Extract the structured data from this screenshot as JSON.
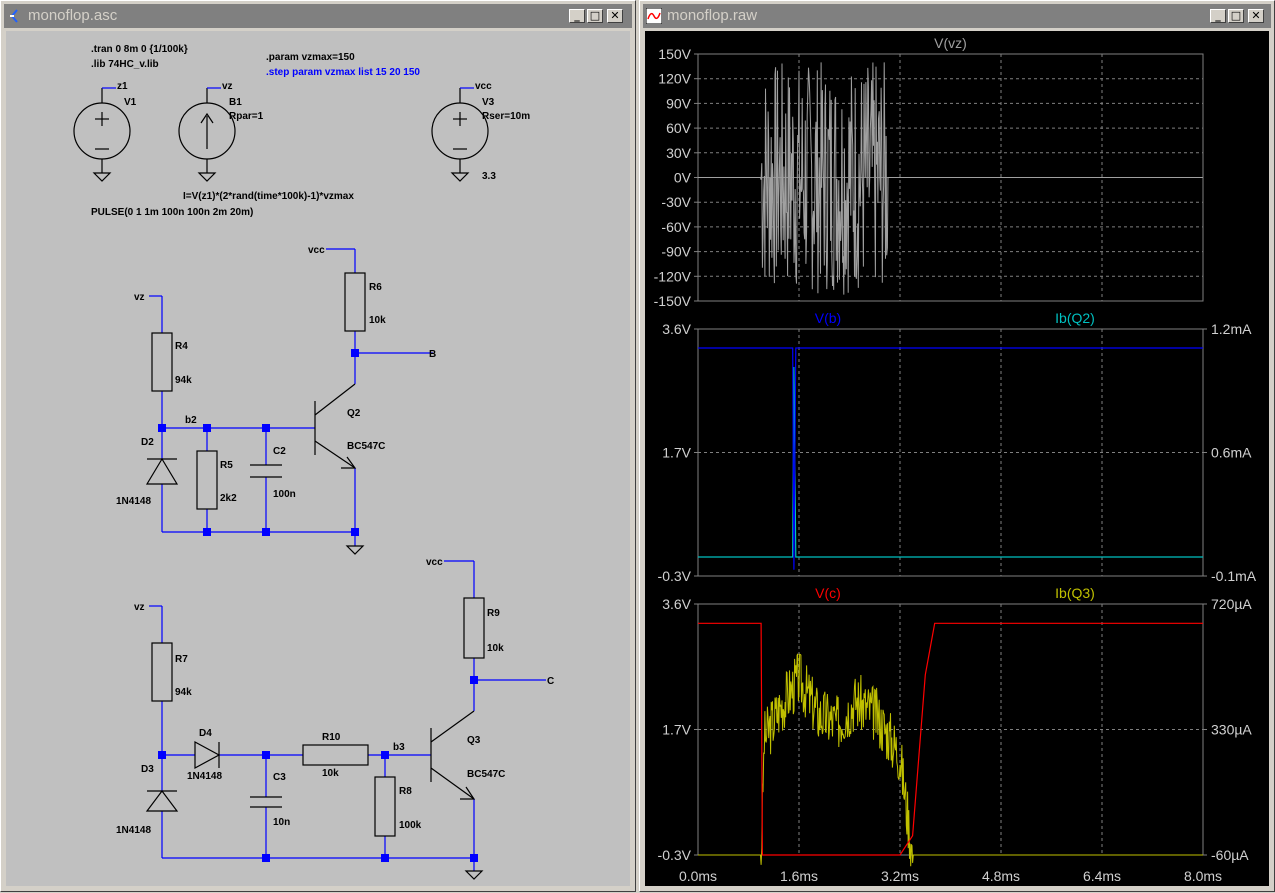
{
  "schematic_window": {
    "title": "monoflop.asc",
    "buttons": {
      "minimize": "_",
      "maximize": "□",
      "close": "✕"
    },
    "directives": {
      "tran": ".tran 0 8m 0 {1/100k}",
      "lib": ".lib 74HC_v.lib",
      "param": ".param vzmax=150",
      "step": ".step param vzmax list 15 20 150"
    },
    "components": {
      "v1": {
        "name": "V1",
        "net": "z1",
        "value": "PULSE(0 1 1m 100n 100n 2m 20m)"
      },
      "b1": {
        "name": "B1",
        "net": "vz",
        "attr": "Rpar=1",
        "value": "I=V(z1)*(2*rand(time*100k)-1)*vzmax"
      },
      "v3": {
        "name": "V3",
        "net": "vcc",
        "attr": "Rser=10m",
        "value": "3.3"
      },
      "r6": {
        "name": "R6",
        "value": "10k",
        "net": "vcc"
      },
      "r4": {
        "name": "R4",
        "value": "94k",
        "net": "vz"
      },
      "q2": {
        "name": "Q2",
        "value": "BC547C"
      },
      "d2": {
        "name": "D2",
        "value": "1N4148"
      },
      "r5": {
        "name": "R5",
        "value": "2k2"
      },
      "c2": {
        "name": "C2",
        "value": "100n"
      },
      "node_b2": "b2",
      "label_b": "B",
      "r9": {
        "name": "R9",
        "value": "10k",
        "net": "vcc"
      },
      "r7": {
        "name": "R7",
        "value": "94k",
        "net": "vz"
      },
      "d4": {
        "name": "D4",
        "value": "1N4148"
      },
      "d3": {
        "name": "D3",
        "value": "1N4148"
      },
      "r10": {
        "name": "R10",
        "value": "10k"
      },
      "c3": {
        "name": "C3",
        "value": "10n"
      },
      "r8": {
        "name": "R8",
        "value": "100k"
      },
      "q3": {
        "name": "Q3",
        "value": "BC547C"
      },
      "node_b3": "b3",
      "label_c": "C"
    }
  },
  "waveform_window": {
    "title": "monoflop.raw",
    "buttons": {
      "minimize": "_",
      "maximize": "□",
      "close": "✕"
    },
    "x_ticks": [
      "0.0ms",
      "1.6ms",
      "3.2ms",
      "4.8ms",
      "6.4ms",
      "8.0ms"
    ],
    "panes": [
      {
        "traces": [
          {
            "label": "V(vz)",
            "color": "#a0a0a0"
          }
        ],
        "left_ticks": [
          "150V",
          "120V",
          "90V",
          "60V",
          "30V",
          "0V",
          "-30V",
          "-60V",
          "-90V",
          "-120V",
          "-150V"
        ],
        "right_ticks": []
      },
      {
        "traces": [
          {
            "label": "V(b)",
            "color": "#0000ff"
          },
          {
            "label": "Ib(Q2)",
            "color": "#00c0c0"
          }
        ],
        "left_ticks": [
          "3.6V",
          "1.7V",
          "-0.3V"
        ],
        "right_ticks": [
          "1.2mA",
          "0.6mA",
          "-0.1mA"
        ]
      },
      {
        "traces": [
          {
            "label": "V(c)",
            "color": "#ff0000"
          },
          {
            "label": "Ib(Q3)",
            "color": "#c0c000"
          }
        ],
        "left_ticks": [
          "3.6V",
          "1.7V",
          "-0.3V"
        ],
        "right_ticks": [
          "720µA",
          "330µA",
          "-60µA"
        ]
      }
    ]
  },
  "chart_data": [
    {
      "type": "line",
      "title": "",
      "xlabel": "",
      "ylabel": "",
      "xlim": [
        0,
        8
      ],
      "ylim": [
        -150,
        150
      ],
      "x_unit": "ms",
      "grid": true,
      "series": [
        {
          "name": "V(vz)",
          "color": "#a0a0a0",
          "note_shape": "random noise between ±150V active only from 1.0ms to 3.0ms, 0V otherwise",
          "x": [
            0,
            1.0,
            3.0,
            8.0
          ],
          "amplitude": [
            0,
            150,
            150,
            0
          ]
        }
      ]
    },
    {
      "type": "line",
      "xlim": [
        0,
        8
      ],
      "ylim": [
        -0.3,
        3.6
      ],
      "y2lim": [
        -0.1,
        1.2
      ],
      "grid": true,
      "series": [
        {
          "name": "V(b)",
          "color": "#0000ff",
          "x": [
            0,
            1.4,
            1.5,
            1.52,
            1.55,
            1.6,
            8.0
          ],
          "y": [
            3.3,
            3.3,
            3.3,
            -0.2,
            3.3,
            3.3,
            3.3
          ]
        },
        {
          "name": "Ib(Q2)",
          "color": "#00c0c0",
          "axis": "right",
          "x": [
            0,
            1.5,
            1.52,
            1.55,
            8.0
          ],
          "y": [
            0,
            0,
            1.0,
            0,
            0
          ]
        }
      ]
    },
    {
      "type": "line",
      "xlim": [
        0,
        8
      ],
      "ylim": [
        -0.3,
        3.6
      ],
      "y2lim": [
        -60,
        720
      ],
      "grid": true,
      "series": [
        {
          "name": "V(c)",
          "color": "#ff0000",
          "x": [
            0,
            1.0,
            1.02,
            3.2,
            3.4,
            3.6,
            3.75,
            8.0
          ],
          "y": [
            3.3,
            3.3,
            -0.3,
            -0.3,
            0.0,
            2.5,
            3.3,
            3.3
          ]
        },
        {
          "name": "Ib(Q3)",
          "color": "#c0c000",
          "axis": "right",
          "x": [
            0,
            1.0,
            1.05,
            1.3,
            1.6,
            1.9,
            2.2,
            2.5,
            2.8,
            3.0,
            3.2,
            3.4,
            8.0
          ],
          "y": [
            -60,
            -60,
            300,
            400,
            490,
            380,
            350,
            420,
            380,
            320,
            250,
            -60,
            -60
          ]
        }
      ]
    }
  ]
}
